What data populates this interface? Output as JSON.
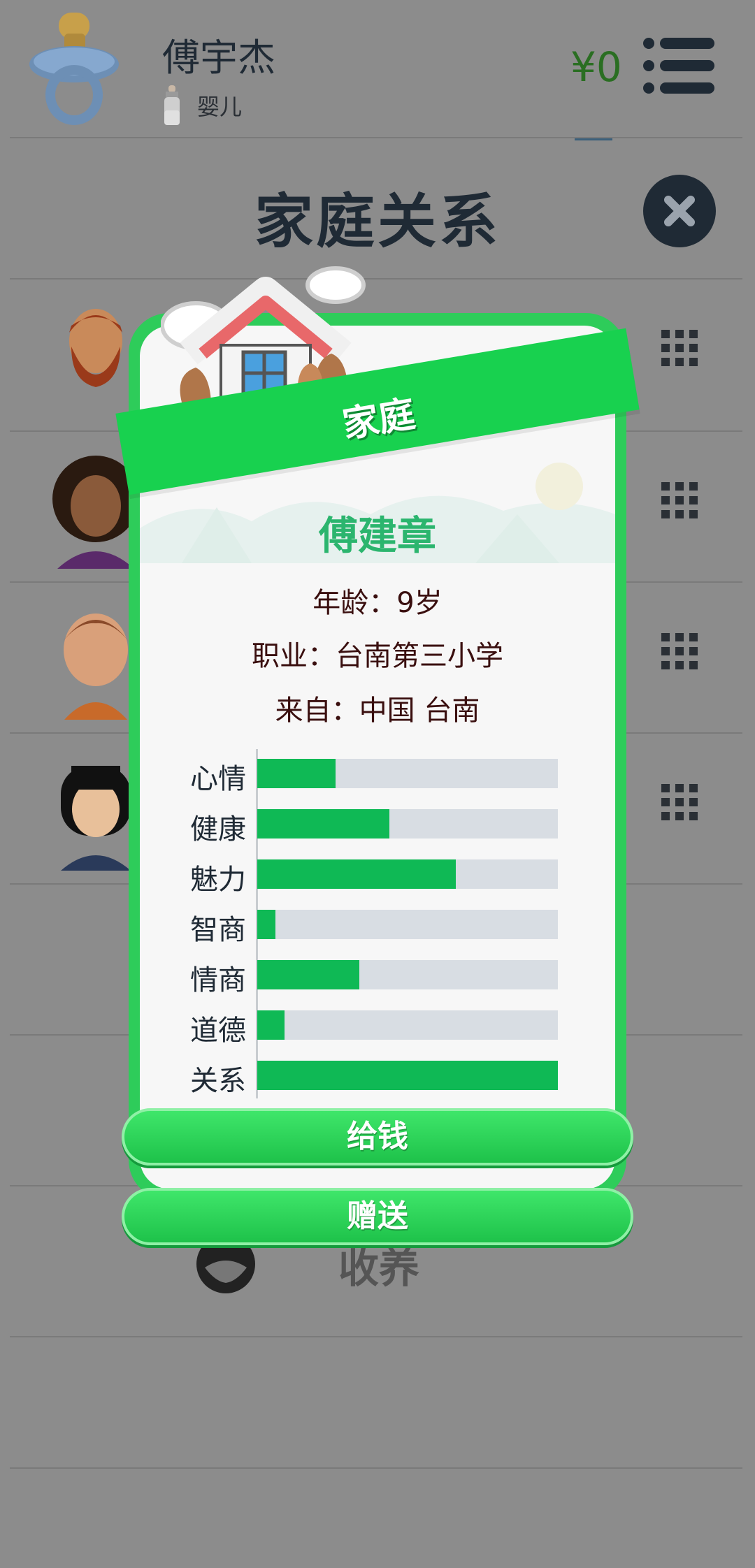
{
  "header": {
    "player_name": "傅宇杰",
    "stage_label": "婴儿",
    "money": "¥0",
    "section_title": "家庭关系"
  },
  "background_list": {
    "adopt_label": "收养"
  },
  "modal": {
    "banner": "家庭",
    "name": "傅建章",
    "age_line": "年龄：9岁",
    "job_line": "职业：台南第三小学",
    "from_line": "来自：中国 台南",
    "stats": [
      {
        "label": "心情",
        "value": 0.26
      },
      {
        "label": "健康",
        "value": 0.44
      },
      {
        "label": "魅力",
        "value": 0.66
      },
      {
        "label": "智商",
        "value": 0.06
      },
      {
        "label": "情商",
        "value": 0.34
      },
      {
        "label": "道德",
        "value": 0.09
      },
      {
        "label": "关系",
        "value": 1.0
      }
    ],
    "give_money_label": "给钱",
    "gift_label": "赠送"
  },
  "colors": {
    "accent_green": "#18d14f",
    "bar_fill": "#0fb955",
    "name_green": "#2bb56e"
  }
}
